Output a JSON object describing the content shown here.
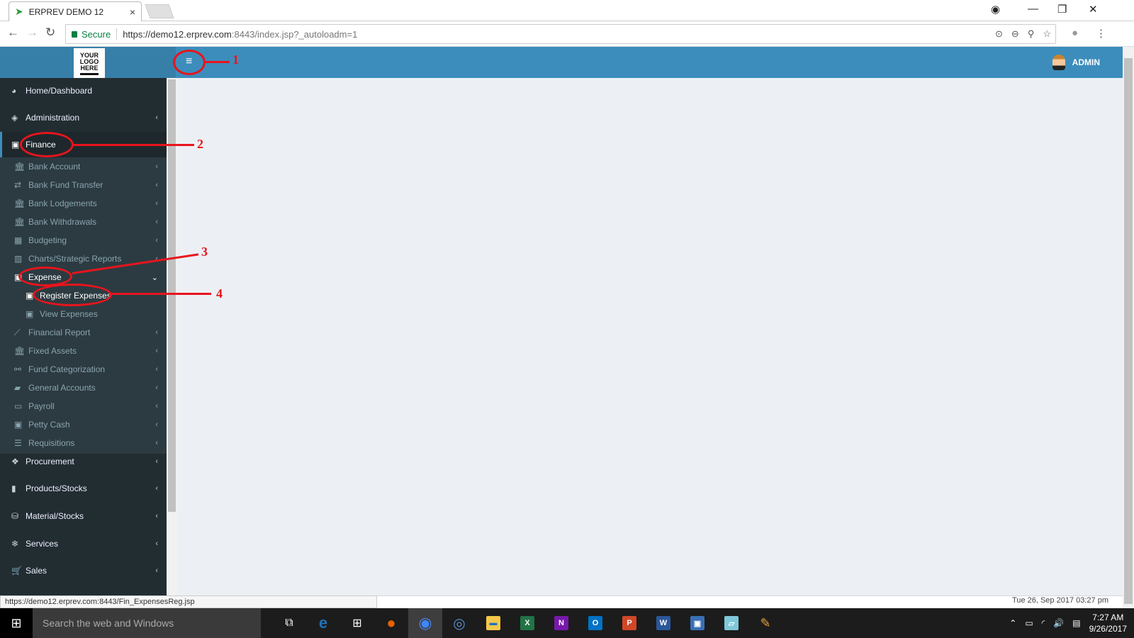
{
  "browser": {
    "tab_title": "ERPREV DEMO 12",
    "tab_close": "×",
    "secure_label": "Secure",
    "url_host": "https://demo12.erprev.com",
    "url_rest": ":8443/index.jsp?_autoloadm=1",
    "status_url": "https://demo12.erprev.com:8443/Fin_ExpensesReg.jsp"
  },
  "header": {
    "logo_lines": [
      "YOUR",
      "LOGO",
      "HERE"
    ],
    "menu_toggle": "≡",
    "user_name": "ADMIN"
  },
  "sidebar": {
    "top_items": [
      {
        "label": "Home/Dashboard",
        "icon": "dashboard-icon"
      },
      {
        "label": "Administration",
        "icon": "tag-icon"
      },
      {
        "label": "Finance",
        "icon": "money-icon"
      }
    ],
    "finance_items": [
      {
        "label": "Bank Account",
        "icon": "bank-icon"
      },
      {
        "label": "Bank Fund Transfer",
        "icon": "exchange-icon"
      },
      {
        "label": "Bank Lodgements",
        "icon": "bank-icon"
      },
      {
        "label": "Bank Withdrawals",
        "icon": "bank-icon"
      },
      {
        "label": "Budgeting",
        "icon": "calculator-icon"
      },
      {
        "label": "Charts/Strategic Reports",
        "icon": "bar-chart-icon"
      },
      {
        "label": "Expense",
        "icon": "money-icon"
      },
      {
        "label": "Financial Report",
        "icon": "line-chart-icon"
      },
      {
        "label": "Fixed Assets",
        "icon": "bank-icon"
      },
      {
        "label": "Fund Categorization",
        "icon": "link-icon"
      },
      {
        "label": "General Accounts",
        "icon": "book-icon"
      },
      {
        "label": "Payroll",
        "icon": "credit-card-icon"
      },
      {
        "label": "Petty Cash",
        "icon": "money-icon"
      },
      {
        "label": "Requisitions",
        "icon": "list-icon"
      }
    ],
    "expense_items": [
      {
        "label": "Register Expenses",
        "icon": "money-icon"
      },
      {
        "label": "View Expenses",
        "icon": "money-icon"
      }
    ],
    "bottom_items": [
      {
        "label": "Procurement",
        "icon": "cubes-icon"
      },
      {
        "label": "Products/Stocks",
        "icon": "building-icon"
      },
      {
        "label": "Material/Stocks",
        "icon": "bucket-icon"
      },
      {
        "label": "Services",
        "icon": "snowflake-icon"
      },
      {
        "label": "Sales",
        "icon": "cart-icon"
      }
    ]
  },
  "footer": {
    "datetime": "Tue 26, Sep 2017 03:27 pm"
  },
  "annotations": [
    "1",
    "2",
    "3",
    "4"
  ],
  "taskbar": {
    "search_placeholder": "Search the web and Windows",
    "time": "7:27 AM",
    "date": "9/26/2017",
    "apps": [
      {
        "name": "task-view",
        "color": "#1c1c1c"
      },
      {
        "name": "edge",
        "color": "#1e73be",
        "glyph": "e"
      },
      {
        "name": "store",
        "color": "#ffffff",
        "glyph": "⊞"
      },
      {
        "name": "firefox",
        "color": "#e66000",
        "glyph": "●"
      },
      {
        "name": "chrome",
        "color": "#4285f4",
        "glyph": "●"
      },
      {
        "name": "safari",
        "color": "#5a8fd6",
        "glyph": "◎"
      },
      {
        "name": "file-explorer",
        "color": "#f4c84a",
        "glyph": "▬"
      },
      {
        "name": "excel",
        "color": "#217346",
        "glyph": "X"
      },
      {
        "name": "onenote",
        "color": "#7719aa",
        "glyph": "N"
      },
      {
        "name": "outlook",
        "color": "#0072c6",
        "glyph": "O"
      },
      {
        "name": "powerpoint",
        "color": "#d24726",
        "glyph": "P"
      },
      {
        "name": "word",
        "color": "#2b579a",
        "glyph": "W"
      },
      {
        "name": "remote-desktop",
        "color": "#3a6fb5",
        "glyph": "▣"
      },
      {
        "name": "notepad",
        "color": "#7fc7d9",
        "glyph": "▱"
      },
      {
        "name": "paint",
        "color": "#e8a23a",
        "glyph": "✎"
      }
    ]
  }
}
